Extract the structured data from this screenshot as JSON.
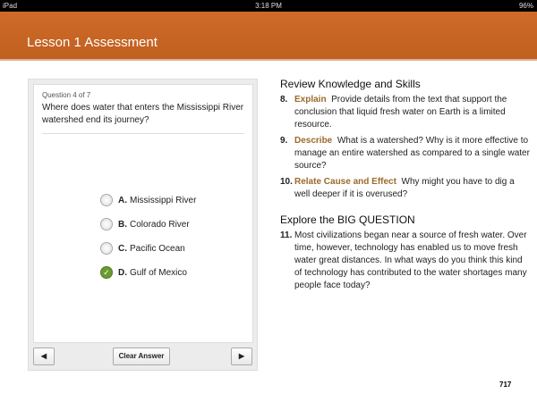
{
  "status": {
    "device": "iPad",
    "time": "3:18 PM",
    "battery": "96%"
  },
  "header": {
    "title": "Lesson 1 Assessment"
  },
  "quiz": {
    "question_number": "Question 4 of 7",
    "question": "Where does water that enters the Mississippi River watershed end its journey?",
    "options": [
      {
        "letter": "A.",
        "text": "Mississippi River",
        "selected": false
      },
      {
        "letter": "B.",
        "text": "Colorado River",
        "selected": false
      },
      {
        "letter": "C.",
        "text": "Pacific Ocean",
        "selected": false
      },
      {
        "letter": "D.",
        "text": "Gulf of Mexico",
        "selected": true
      }
    ],
    "clear_label": "Clear Answer",
    "prev_icon": "◀",
    "next_icon": "▶",
    "check": "✓"
  },
  "review": {
    "heading": "Review Knowledge and Skills",
    "items": [
      {
        "num": "8.",
        "key": "Explain",
        "text": "Provide details from the text that support the conclusion that liquid fresh water on Earth is a limited resource."
      },
      {
        "num": "9.",
        "key": "Describe",
        "text": "What is a watershed? Why is it more effective to manage an entire watershed as compared to a single water source?"
      },
      {
        "num": "10.",
        "key": "Relate Cause and Effect",
        "text": "Why might you have to dig a well deeper if it is overused?"
      }
    ]
  },
  "big": {
    "heading": "Explore the BIG QUESTION",
    "items": [
      {
        "num": "11.",
        "text": "Most civilizations began near a source of fresh water. Over time, however, technology has enabled us to move fresh water great distances. In what ways do you think this kind of technology has contributed to the water shortages many people face today?"
      }
    ]
  },
  "page_number": "717"
}
